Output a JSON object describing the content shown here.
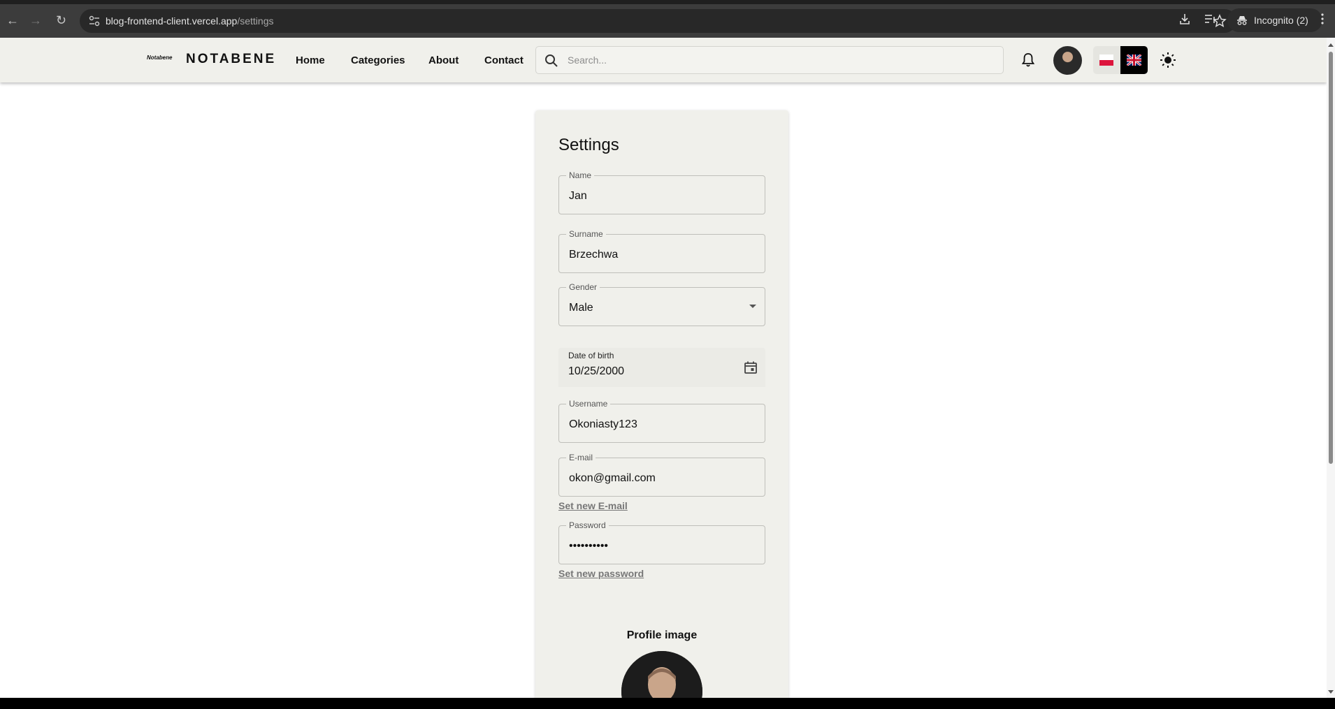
{
  "browser": {
    "url_host": "blog-frontend-client.vercel.app",
    "url_path": "/settings",
    "incognito_label": "Incognito (2)"
  },
  "header": {
    "logo_mark": "Notabene",
    "brand": "NOTABENE",
    "nav": [
      "Home",
      "Categories",
      "About",
      "Contact"
    ],
    "search_placeholder": "Search..."
  },
  "settings": {
    "title": "Settings",
    "fields": {
      "name": {
        "label": "Name",
        "value": "Jan"
      },
      "surname": {
        "label": "Surname",
        "value": "Brzechwa"
      },
      "gender": {
        "label": "Gender",
        "value": "Male"
      },
      "dob": {
        "label": "Date of birth",
        "value": "10/25/2000"
      },
      "username": {
        "label": "Username",
        "value": "Okoniasty123"
      },
      "email": {
        "label": "E-mail",
        "value": "okon@gmail.com"
      },
      "password": {
        "label": "Password",
        "value": "••••••••••"
      }
    },
    "set_email_link": "Set new E-mail",
    "set_password_link": "Set new password",
    "profile_image_title": "Profile image"
  }
}
